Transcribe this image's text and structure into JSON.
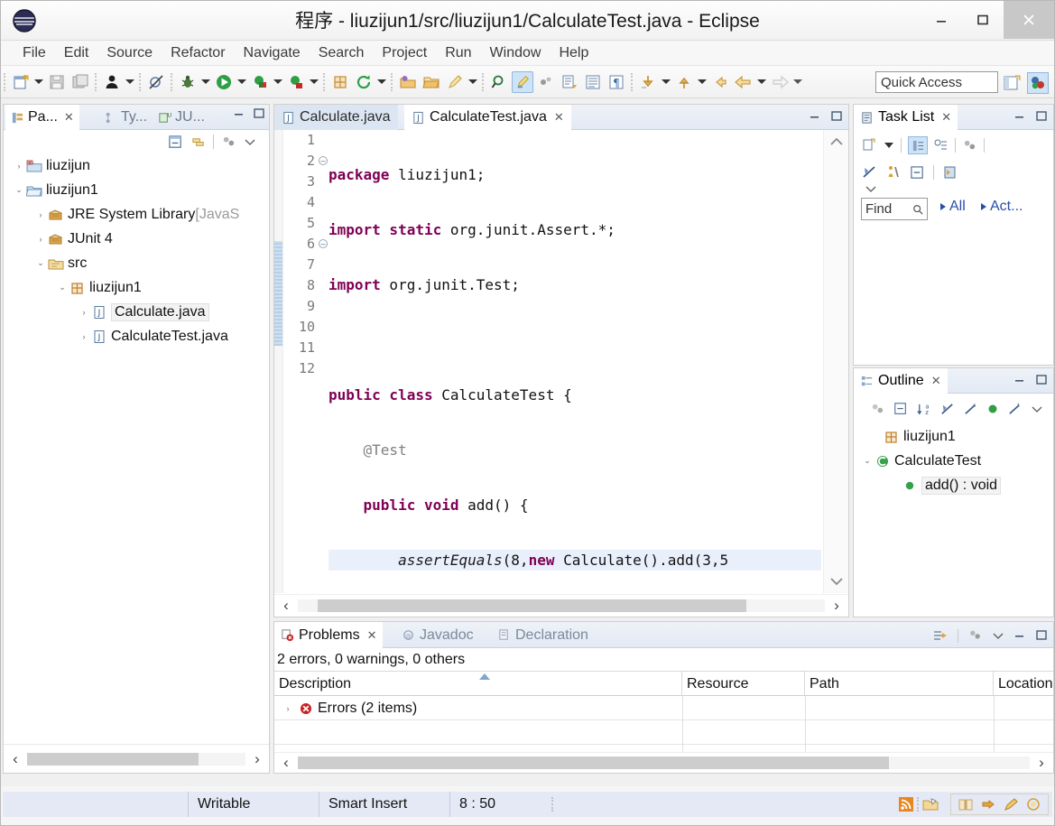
{
  "window": {
    "title": "程序 - liuzijun1/src/liuzijun1/CalculateTest.java - Eclipse",
    "minimize": "–",
    "maximize": "▢",
    "close": "✕"
  },
  "menubar": {
    "items": [
      "File",
      "Edit",
      "Source",
      "Refactor",
      "Navigate",
      "Search",
      "Project",
      "Run",
      "Window",
      "Help"
    ]
  },
  "toolbar": {
    "quick_access_placeholder": "Quick Access"
  },
  "left_panel": {
    "tabs": [
      {
        "label": "Pa...",
        "active": true,
        "icon": "package-explorer-icon"
      },
      {
        "label": "Ty...",
        "active": false,
        "icon": "type-hierarchy-icon"
      },
      {
        "label": "JU...",
        "active": false,
        "icon": "junit-icon"
      }
    ],
    "tree": [
      {
        "label": "liuzijun",
        "icon": "java-project-closed-icon",
        "arrow": "collapsed",
        "indent": 0,
        "selected": false,
        "dim": ""
      },
      {
        "label": "liuzijun1",
        "icon": "java-project-open-icon",
        "arrow": "expanded",
        "indent": 0,
        "selected": false,
        "dim": ""
      },
      {
        "label": "JRE System Library ",
        "dim": "[JavaS",
        "icon": "library-icon",
        "arrow": "collapsed",
        "indent": 1,
        "selected": false
      },
      {
        "label": "JUnit 4",
        "icon": "library-icon",
        "arrow": "collapsed",
        "indent": 1,
        "selected": false,
        "dim": ""
      },
      {
        "label": "src",
        "icon": "source-folder-icon",
        "arrow": "expanded",
        "indent": 1,
        "selected": false,
        "dim": ""
      },
      {
        "label": "liuzijun1",
        "icon": "package-icon",
        "arrow": "expanded",
        "indent": 2,
        "selected": false,
        "dim": ""
      },
      {
        "label": "Calculate.java",
        "icon": "java-file-icon",
        "arrow": "collapsed",
        "indent": 3,
        "selected": true,
        "dim": ""
      },
      {
        "label": "CalculateTest.java",
        "icon": "java-file-icon",
        "arrow": "collapsed",
        "indent": 3,
        "selected": false,
        "dim": ""
      }
    ]
  },
  "editor": {
    "tabs": [
      {
        "label": "Calculate.java",
        "active": false,
        "closable": false
      },
      {
        "label": "CalculateTest.java",
        "active": true,
        "closable": true
      }
    ],
    "cursor_line": 8,
    "highlighted_line": 8,
    "lines": [
      {
        "n": 1,
        "fold": false,
        "tokens": [
          {
            "t": "package",
            "c": "kw"
          },
          {
            "t": " liuzijun1;",
            "c": ""
          }
        ]
      },
      {
        "n": 2,
        "fold": true,
        "tokens": [
          {
            "t": "import static",
            "c": "kw"
          },
          {
            "t": " org.junit.Assert.*;",
            "c": ""
          }
        ]
      },
      {
        "n": 3,
        "fold": false,
        "tokens": [
          {
            "t": "import",
            "c": "kw"
          },
          {
            "t": " org.junit.Test;",
            "c": ""
          }
        ]
      },
      {
        "n": 4,
        "fold": false,
        "tokens": []
      },
      {
        "n": 5,
        "fold": false,
        "tokens": [
          {
            "t": "public class",
            "c": "kw"
          },
          {
            "t": " CalculateTest {",
            "c": ""
          }
        ]
      },
      {
        "n": 6,
        "fold": true,
        "tokens": [
          {
            "t": "    @Test",
            "c": "ann"
          }
        ]
      },
      {
        "n": 7,
        "fold": false,
        "tokens": [
          {
            "t": "    ",
            "c": ""
          },
          {
            "t": "public void",
            "c": "kw"
          },
          {
            "t": " add() {",
            "c": ""
          }
        ]
      },
      {
        "n": 8,
        "fold": false,
        "tokens": [
          {
            "t": "        ",
            "c": ""
          },
          {
            "t": "assertEquals",
            "c": "stat"
          },
          {
            "t": "(8,",
            "c": ""
          },
          {
            "t": "new",
            "c": "kw"
          },
          {
            "t": " Calculate().add(3,5",
            "c": ""
          }
        ]
      },
      {
        "n": 9,
        "fold": false,
        "tokens": [
          {
            "t": "    }",
            "c": ""
          }
        ]
      },
      {
        "n": 10,
        "fold": false,
        "tokens": []
      },
      {
        "n": 11,
        "fold": false,
        "tokens": [
          {
            "t": "}",
            "c": ""
          }
        ]
      },
      {
        "n": 12,
        "fold": false,
        "tokens": []
      }
    ]
  },
  "task_list": {
    "title": "Task List",
    "find_label": "Find",
    "link_all": "All",
    "link_active": "Act..."
  },
  "outline": {
    "title": "Outline",
    "items": [
      {
        "label": "liuzijun1",
        "icon": "package-icon",
        "indent": 0,
        "arrow": "",
        "selected": false
      },
      {
        "label": "CalculateTest",
        "icon": "class-icon",
        "indent": 0,
        "arrow": "expanded",
        "selected": false
      },
      {
        "label": "add() : void",
        "icon": "method-public-icon",
        "indent": 1,
        "arrow": "",
        "selected": true
      }
    ]
  },
  "problems": {
    "tabs": [
      {
        "label": "Problems",
        "active": true,
        "closable": true,
        "icon": "problems-icon"
      },
      {
        "label": "Javadoc",
        "active": false,
        "closable": false,
        "icon": "javadoc-icon"
      },
      {
        "label": "Declaration",
        "active": false,
        "closable": false,
        "icon": "declaration-icon"
      }
    ],
    "summary": "2 errors, 0 warnings, 0 others",
    "columns": [
      "Description",
      "Resource",
      "Path",
      "Location"
    ],
    "rows": [
      {
        "description": "Errors (2 items)",
        "resource": "",
        "path": "",
        "location": "",
        "icon": "error-icon",
        "arrow": "collapsed"
      },
      {
        "description": "",
        "resource": "",
        "path": "",
        "location": "",
        "icon": "",
        "arrow": ""
      },
      {
        "description": "",
        "resource": "",
        "path": "",
        "location": "",
        "icon": "",
        "arrow": ""
      }
    ]
  },
  "statusbar": {
    "writable": "Writable",
    "insert_mode": "Smart Insert",
    "position": "8 : 50"
  },
  "colors": {
    "keyword": "#7f0055",
    "accent_tab": "#dce6f3",
    "selection": "#eaf0fb",
    "link": "#2a4fa8",
    "error": "#cc0000"
  }
}
